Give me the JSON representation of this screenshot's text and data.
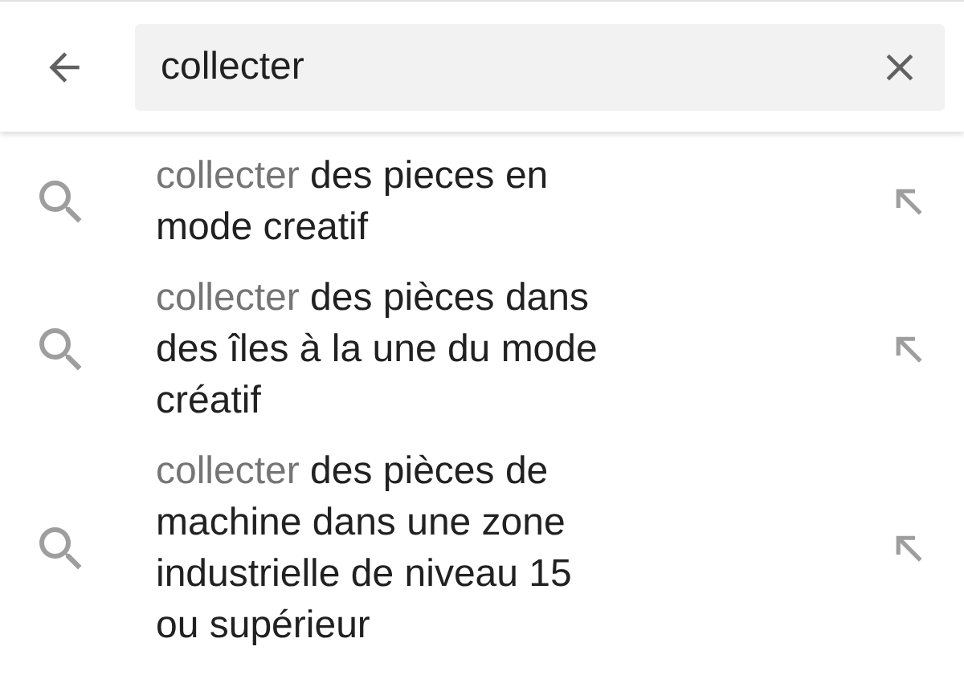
{
  "search": {
    "value": "collecter"
  },
  "suggestions": [
    {
      "query": "collecter",
      "rest": " des pieces en mode creatif"
    },
    {
      "query": "collecter",
      "rest": " des pièces dans des îles à la une du mode créatif"
    },
    {
      "query": "collecter",
      "rest": " des pièces de machine dans une zone industrielle de niveau 15 ou supérieur"
    }
  ]
}
